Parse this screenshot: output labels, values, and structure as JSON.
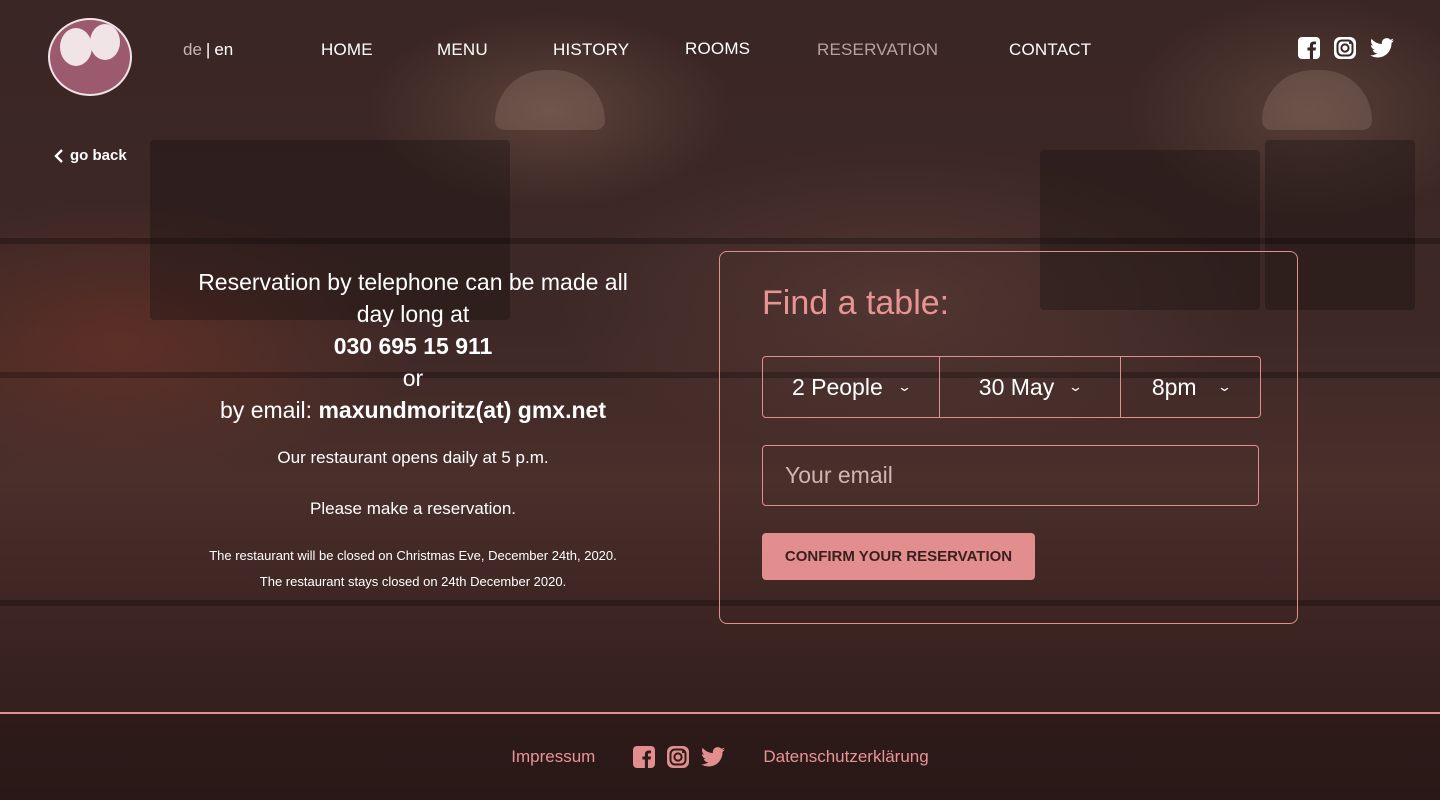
{
  "header": {
    "logo_alt": "Max und Moritz logo",
    "lang": {
      "de": "de",
      "separator": "|",
      "en": "en"
    },
    "nav": [
      {
        "label": "HOME"
      },
      {
        "label": "MENU"
      },
      {
        "label": "HISTORY"
      },
      {
        "label": "ROOMS"
      },
      {
        "label": "RESERVATION"
      },
      {
        "label": "CONTACT"
      }
    ],
    "social": [
      "facebook-icon",
      "instagram-icon",
      "twitter-icon"
    ]
  },
  "back_link": "go back",
  "info": {
    "line1": "Reservation by telephone can be made all day long at",
    "phone": "030 695 15 911",
    "or": "or",
    "email_prefix": "by email:",
    "email": "maxundmoritz(at) gmx.net",
    "opens": "Our restaurant opens daily at 5 p.m.",
    "please": "Please make a reservation.",
    "closed1": "The restaurant will be closed on Christmas Eve, December 24th, 2020.",
    "closed2": "The restaurant stays closed on 24th December 2020."
  },
  "form": {
    "title": "Find a table:",
    "people": "2 People",
    "date": "30 May",
    "time": "8pm",
    "email_placeholder": "Your email",
    "confirm_label": "CONFIRM YOUR RESERVATION"
  },
  "footer": {
    "impressum": "Impressum",
    "datenschutz": "Datenschutzerklärung"
  },
  "colors": {
    "accent": "#e28d8e",
    "title": "#e89494",
    "active_nav": "#b8a19f"
  }
}
